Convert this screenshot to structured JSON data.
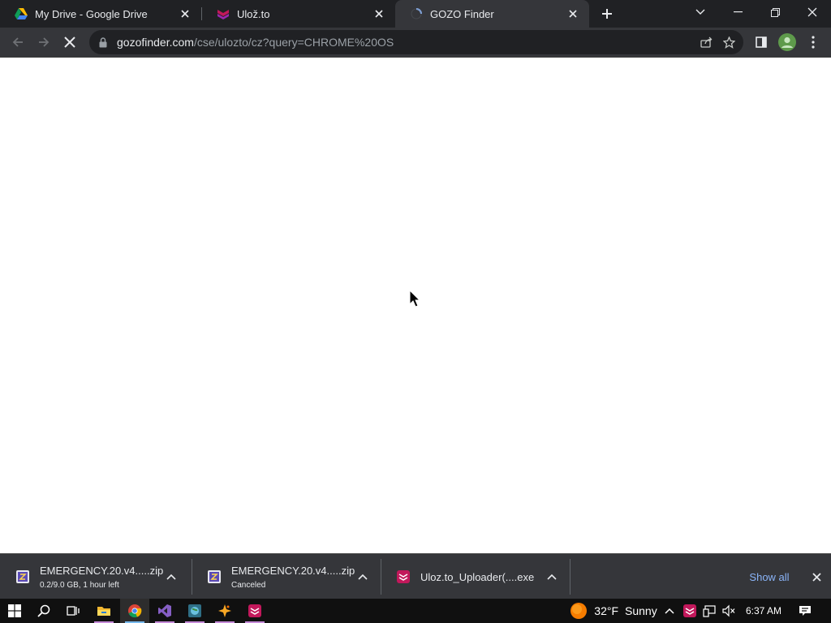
{
  "tabs": [
    {
      "title": "My Drive - Google Drive",
      "icon": "google-drive-icon"
    },
    {
      "title": "Ulož.to",
      "icon": "ulozto-icon"
    },
    {
      "title": "GOZO Finder",
      "icon": "loading-spinner-icon",
      "active": true,
      "loading": true
    }
  ],
  "address_bar": {
    "host": "gozofinder.com",
    "path": "/cse/ulozto/cz?query=CHROME%20OS"
  },
  "downloads": [
    {
      "name": "EMERGENCY.20.v4.....zip",
      "status": "0.2/9.0 GB, 1 hour left",
      "icon": "zip-archive-icon"
    },
    {
      "name": "EMERGENCY.20.v4.....zip",
      "status": "Canceled",
      "icon": "zip-archive-icon"
    },
    {
      "name": "Uloz.to_Uploader(....exe",
      "status": "",
      "icon": "ulozto-icon"
    }
  ],
  "shelf": {
    "show_all_label": "Show all"
  },
  "taskbar": {
    "apps": [
      "start-icon",
      "search-icon",
      "task-view-icon",
      "file-explorer-icon",
      "chrome-icon",
      "visual-studio-icon",
      "globe-app-icon",
      "sparkle-app-icon",
      "ulozto-icon"
    ]
  },
  "tray": {
    "temperature": "32°F",
    "weather": "Sunny",
    "time": "6:37 AM"
  },
  "colors": {
    "titlebar": "#202124",
    "toolbar": "#35363a",
    "accent_link": "#8ab4f8",
    "ulozto_brand": "#c2185b"
  }
}
